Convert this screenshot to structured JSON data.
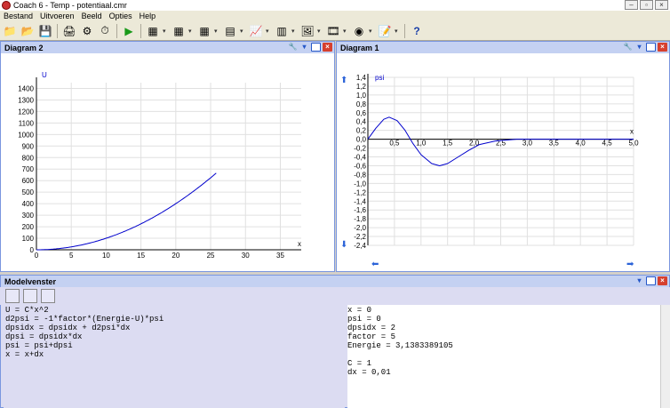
{
  "window": {
    "title": "Coach 6 - Temp - potentiaal.cmr"
  },
  "menu": [
    "Bestand",
    "Uitvoeren",
    "Beeld",
    "Opties",
    "Help"
  ],
  "diagram2": {
    "title": "Diagram 2",
    "chart_data": {
      "type": "line",
      "ylabel": "U",
      "xlabel": "x",
      "xlim": [
        0,
        38
      ],
      "ylim": [
        0,
        1450
      ],
      "xticks": [
        0,
        5,
        10,
        15,
        20,
        25,
        30,
        35
      ],
      "yticks": [
        0,
        100,
        200,
        300,
        400,
        500,
        600,
        700,
        800,
        900,
        1000,
        1100,
        1200,
        1300,
        1400
      ],
      "series": [
        {
          "formula": "U=x^2",
          "x_range": [
            0,
            25.8
          ],
          "color": "#0000cc"
        }
      ]
    }
  },
  "diagram1": {
    "title": "Diagram 1",
    "chart_data": {
      "type": "line",
      "ylabel": "psi",
      "xlabel": "x",
      "xlim": [
        0,
        5
      ],
      "ylim": [
        -2.4,
        1.4
      ],
      "xticks": [
        "0,5",
        "1,0",
        "1,5",
        "2,0",
        "2,5",
        "3,0",
        "3,5",
        "4,0",
        "4,5",
        "5,0"
      ],
      "yticks": [
        "1,4",
        "1,2",
        "1,0",
        "0,8",
        "0,6",
        "0,4",
        "0,2",
        "0,0",
        "-0,2",
        "-0,4",
        "-0,6",
        "-0,8",
        "-1,0",
        "-1,2",
        "-1,4",
        "-1,6",
        "-1,8",
        "-2,0",
        "-2,2",
        "-2,4"
      ],
      "series": [
        {
          "points": [
            [
              0,
              0
            ],
            [
              0.15,
              0.25
            ],
            [
              0.3,
              0.45
            ],
            [
              0.4,
              0.5
            ],
            [
              0.55,
              0.42
            ],
            [
              0.7,
              0.2
            ],
            [
              0.85,
              -0.1
            ],
            [
              1.0,
              -0.35
            ],
            [
              1.2,
              -0.55
            ],
            [
              1.35,
              -0.6
            ],
            [
              1.5,
              -0.55
            ],
            [
              1.7,
              -0.4
            ],
            [
              1.9,
              -0.25
            ],
            [
              2.1,
              -0.12
            ],
            [
              2.4,
              -0.04
            ],
            [
              2.8,
              0.0
            ],
            [
              5.0,
              0.0
            ]
          ],
          "color": "#0000cc"
        }
      ]
    }
  },
  "model": {
    "title": "Modelvenster",
    "equations": [
      "U = C*x^2",
      "d2psi = -1*factor*(Energie-U)*psi",
      "dpsidx = dpsidx + d2psi*dx",
      "dpsi = dpsidx*dx",
      "psi = psi+dpsi",
      "x = x+dx"
    ],
    "initial": [
      "x = 0",
      "psi = 0",
      "dpsidx = 2",
      "factor = 5",
      "Energie = 3,1383389105",
      "",
      "C = 1",
      "dx = 0,01"
    ]
  }
}
